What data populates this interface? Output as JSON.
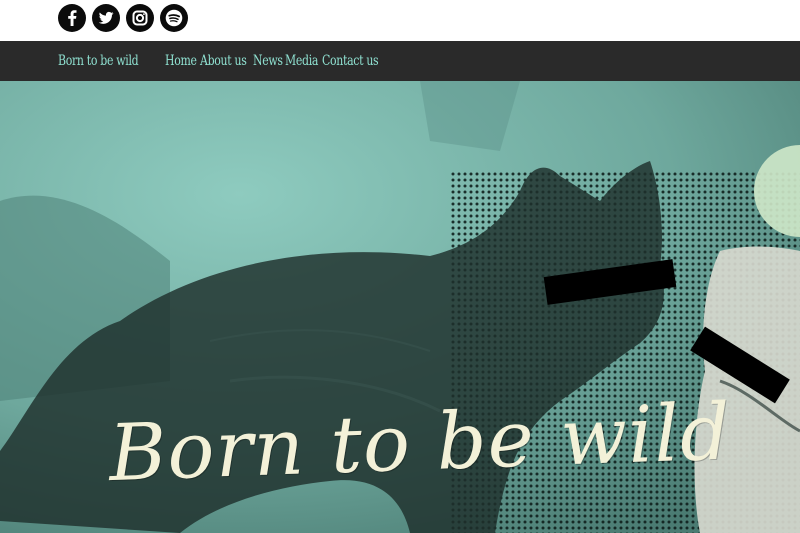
{
  "social": {
    "icons": [
      {
        "name": "facebook-icon",
        "glyph": "f"
      },
      {
        "name": "twitter-icon"
      },
      {
        "name": "instagram-icon"
      },
      {
        "name": "spotify-icon"
      }
    ]
  },
  "nav": {
    "brand": "Born to be wild",
    "items": [
      "Home",
      "About us",
      "News",
      "Media",
      "Contact us"
    ],
    "text_color": "#8fe0d0",
    "background": "#2a2a2a"
  },
  "hero": {
    "title": "Born to be wild",
    "title_color": "#f3f1d8",
    "background_color": "#74b3a8"
  }
}
